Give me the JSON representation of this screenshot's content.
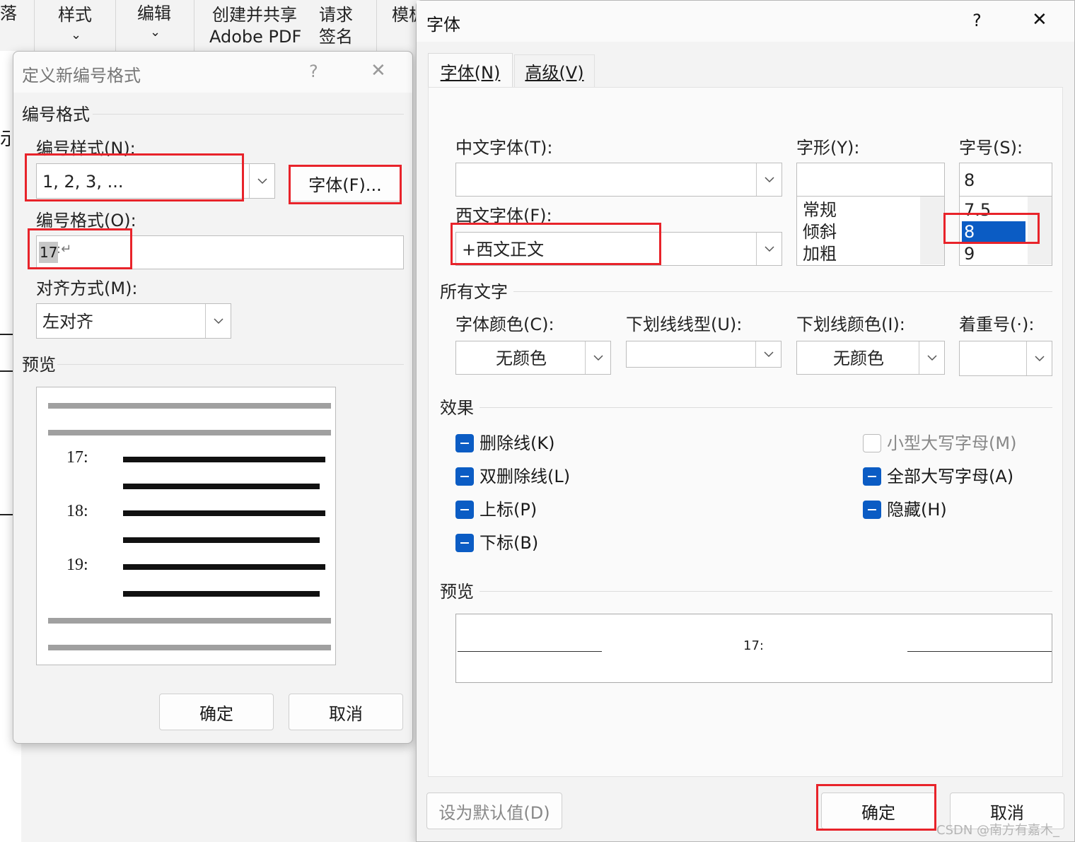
{
  "ribbon": {
    "partial_left": "落",
    "style_label": "样式",
    "edit_label": "编辑",
    "share_label_1": "创建并共享",
    "share_label_2": "Adobe PDF",
    "sign_label_1": "请求",
    "sign_label_2": "签名",
    "template_label": "模板",
    "chevron": "⌄"
  },
  "doc": {
    "partial_char": "示"
  },
  "numbering_dialog": {
    "title": "定义新编号格式",
    "help": "?",
    "close": "✕",
    "group_format": "编号格式",
    "style_label": "编号样式(N):",
    "style_value": "1, 2, 3, ...",
    "font_button": "字体(F)...",
    "format_label": "编号格式(O):",
    "format_value": "17",
    "format_suffix": ":↵",
    "align_label": "对齐方式(M):",
    "align_value": "左对齐",
    "group_preview": "预览",
    "preview_numbers": [
      "17:",
      "18:",
      "19:"
    ],
    "ok": "确定",
    "cancel": "取消"
  },
  "font_dialog": {
    "title": "字体",
    "help": "?",
    "close": "✕",
    "tabs": [
      {
        "label": "字体(N)",
        "active": true
      },
      {
        "label": "高级(V)",
        "active": false
      }
    ],
    "cn_font_label": "中文字体(T):",
    "cn_font_value": "",
    "west_font_label": "西文字体(F):",
    "west_font_value": "+西文正文",
    "style_label": "字形(Y):",
    "style_value": "",
    "style_options": [
      "常规",
      "倾斜",
      "加粗"
    ],
    "size_label": "字号(S):",
    "size_value": "8",
    "size_options": [
      "7.5",
      "8",
      "9"
    ],
    "size_selected": "8",
    "group_all": "所有文字",
    "color_label": "字体颜色(C):",
    "color_value": "无颜色",
    "underline_label": "下划线线型(U):",
    "underline_value": "",
    "ucolor_label": "下划线颜色(I):",
    "ucolor_value": "无颜色",
    "emph_label": "着重号(·):",
    "emph_value": "",
    "group_effects": "效果",
    "effects_left": [
      "删除线(K)",
      "双删除线(L)",
      "上标(P)",
      "下标(B)"
    ],
    "effects_right": [
      {
        "label": "小型大写字母(M)",
        "state": "unchecked"
      },
      {
        "label": "全部大写字母(A)",
        "state": "indeterminate"
      },
      {
        "label": "隐藏(H)",
        "state": "indeterminate"
      }
    ],
    "group_preview": "预览",
    "preview_text": "17:",
    "default_button": "设为默认值(D)",
    "ok": "确定",
    "cancel": "取消"
  },
  "watermark": "CSDN @南方有嘉木_",
  "colors": {
    "highlight": "#e8232a",
    "accent": "#0b5cc4"
  }
}
